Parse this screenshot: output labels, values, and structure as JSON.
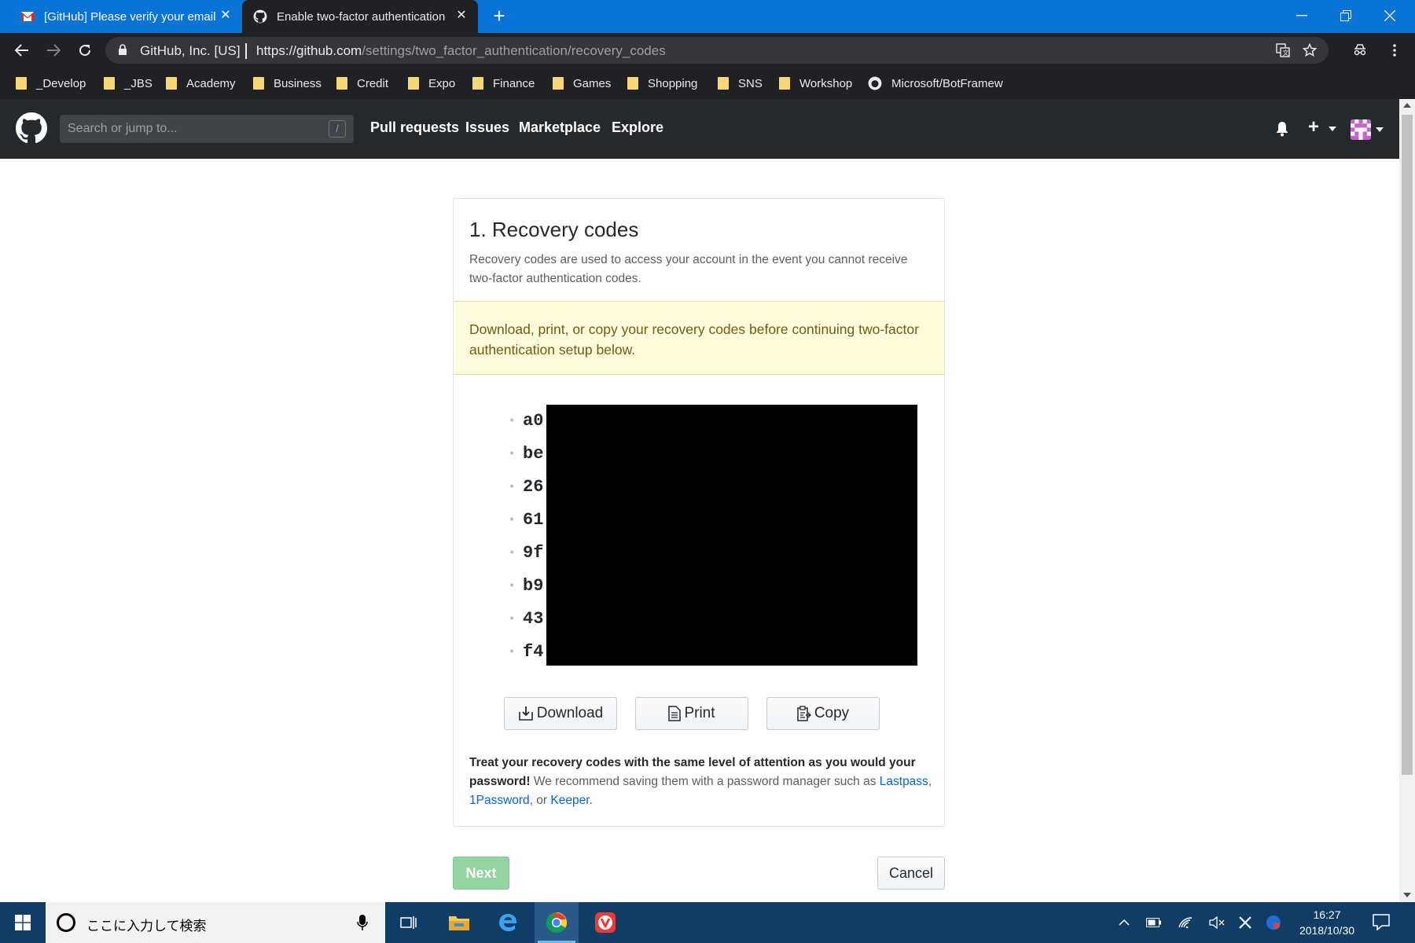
{
  "browser": {
    "tabs": [
      {
        "title": "[GitHub] Please verify your email",
        "icon": "gmail-icon"
      },
      {
        "title": "Enable two-factor authentication",
        "icon": "github-icon"
      }
    ],
    "site_identity": "GitHub, Inc. [US]",
    "url_scheme": "https://",
    "url_host": "github.com",
    "url_path": "/settings/two_factor_authentication/recovery_codes",
    "bookmarks": [
      "_Develop",
      "_JBS",
      "Academy",
      "Business",
      "Credit",
      "Expo",
      "Finance",
      "Games",
      "Shopping",
      "SNS",
      "Workshop",
      "Microsoft/BotFramew"
    ]
  },
  "github": {
    "search_placeholder": "Search or jump to...",
    "search_shortcut": "/",
    "nav": [
      "Pull requests",
      "Issues",
      "Marketplace",
      "Explore"
    ],
    "plus_label": "+"
  },
  "recovery": {
    "title": "1. Recovery codes",
    "description": "Recovery codes are used to access your account in the event you cannot receive two-factor authentication codes.",
    "flash": "Download, print, or copy your recovery codes before continuing two-factor authentication setup below.",
    "codes_visible_prefixes": [
      "a0",
      "be",
      "26",
      "61",
      "9f",
      "b9",
      "43",
      "f4"
    ],
    "buttons": {
      "download": "Download",
      "print": "Print",
      "copy": "Copy"
    },
    "note_bold": "Treat your recovery codes with the same level of attention as you would your password!",
    "note_rest": " We recommend saving them with a password manager such as ",
    "links": [
      "Lastpass",
      "1Password",
      "Keeper"
    ],
    "link_sep_1": ", ",
    "link_sep_2": ", or ",
    "note_end": "."
  },
  "actions": {
    "next": "Next",
    "cancel": "Cancel"
  },
  "taskbar": {
    "search_placeholder": "ここに入力して検索",
    "time": "16:27",
    "date": "2018/10/30"
  },
  "colors": {
    "tabstrip": "#0a74d6",
    "browser_dark": "#202124",
    "github_header": "#24292e",
    "flash_bg": "#fffbdd",
    "link": "#0366d6",
    "next_button": "#94d3a2",
    "taskbar": "#0f3d66"
  }
}
